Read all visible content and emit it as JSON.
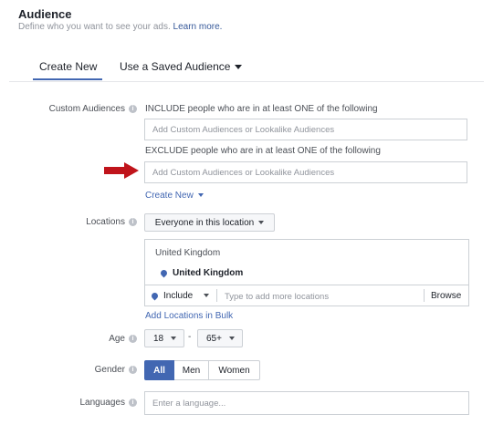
{
  "header": {
    "title": "Audience",
    "subtitle": "Define who you want to see your ads.",
    "learn_more": "Learn more."
  },
  "tabs": [
    {
      "label": "Create New",
      "active": true
    },
    {
      "label": "Use a Saved Audience",
      "active": false
    }
  ],
  "custom_audiences": {
    "label": "Custom Audiences",
    "include_hint": "INCLUDE people who are in at least ONE of the following",
    "include_placeholder": "Add Custom Audiences or Lookalike Audiences",
    "exclude_hint": "EXCLUDE people who are in at least ONE of the following",
    "exclude_placeholder": "Add Custom Audiences or Lookalike Audiences",
    "create_new": "Create New"
  },
  "locations": {
    "label": "Locations",
    "scope": "Everyone in this location",
    "group_title": "United Kingdom",
    "selected": "United Kingdom",
    "include_label": "Include",
    "input_placeholder": "Type to add more locations",
    "browse": "Browse",
    "bulk_link": "Add Locations in Bulk"
  },
  "age": {
    "label": "Age",
    "min": "18",
    "separator": "-",
    "max": "65+"
  },
  "gender": {
    "label": "Gender",
    "options": [
      "All",
      "Men",
      "Women"
    ],
    "selected": "All"
  },
  "languages": {
    "label": "Languages",
    "placeholder": "Enter a language..."
  },
  "colors": {
    "accent": "#4267b2",
    "arrow": "#c0141b",
    "border": "#ccd0d5"
  }
}
